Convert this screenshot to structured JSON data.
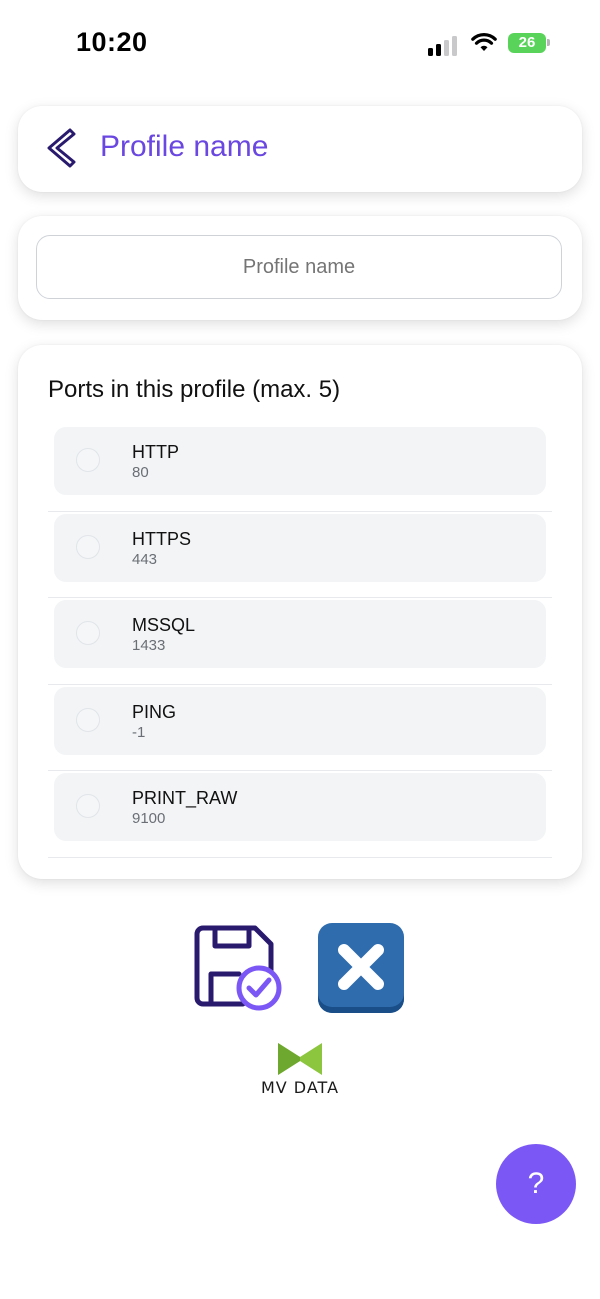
{
  "status_bar": {
    "time": "10:20",
    "battery_level": "26",
    "signal_bars_active": 2,
    "signal_bars_total": 4,
    "icons": [
      "cellular-signal-icon",
      "wifi-icon",
      "battery-icon"
    ]
  },
  "header": {
    "title": "Profile name",
    "back_icon": "chevron-left-icon"
  },
  "profile_name_input": {
    "value": "",
    "placeholder": "Profile name"
  },
  "ports": {
    "title": "Ports in this profile (max. 5)",
    "items": [
      {
        "name": "HTTP",
        "port": "80",
        "selected": false
      },
      {
        "name": "HTTPS",
        "port": "443",
        "selected": false
      },
      {
        "name": "MSSQL",
        "port": "1433",
        "selected": false
      },
      {
        "name": "PING",
        "port": "-1",
        "selected": false
      },
      {
        "name": "PRINT_RAW",
        "port": "9100",
        "selected": false
      }
    ]
  },
  "actions": {
    "save_icon": "floppy-disk-check-icon",
    "cancel_icon": "close-x-icon"
  },
  "logo": {
    "text": "MV DATA"
  },
  "help": {
    "label": "?"
  },
  "colors": {
    "accent": "#6a47e0",
    "help_button": "#7b58f5",
    "cancel_button": "#2f6cad",
    "logo_green": "#8cc63f",
    "battery_green": "#5ad35a"
  }
}
